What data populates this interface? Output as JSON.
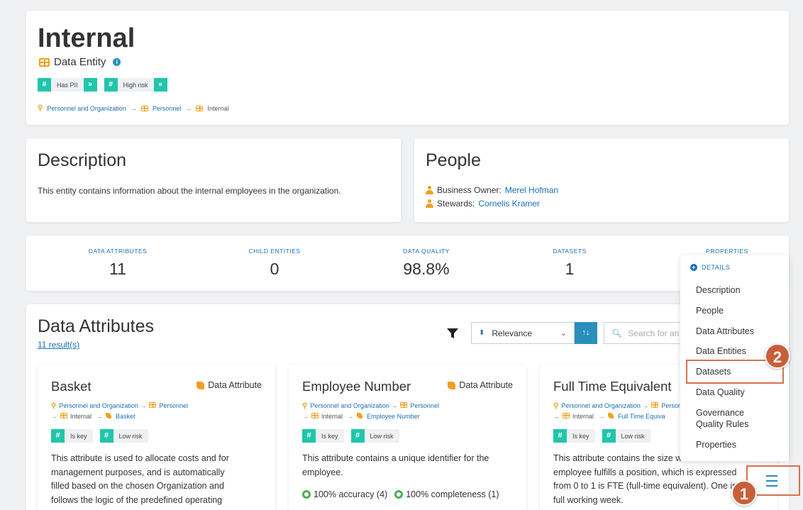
{
  "header": {
    "title": "Internal",
    "entity_type": "Data Entity",
    "tags": [
      "Has PII",
      "High risk"
    ],
    "breadcrumb": [
      "Personnel and Organization",
      "Personnel",
      "Internal"
    ]
  },
  "description": {
    "title": "Description",
    "text": "This entity contains information about the internal employees in the organization."
  },
  "people": {
    "title": "People",
    "business_owner_label": "Business Owner:",
    "business_owner": "Merel Hofman",
    "stewards_label": "Stewards:",
    "stewards": "Cornelis Kramer"
  },
  "stats": [
    {
      "label": "DATA ATTRIBUTES",
      "value": "11"
    },
    {
      "label": "CHILD ENTITIES",
      "value": "0"
    },
    {
      "label": "DATA QUALITY",
      "value": "98.8%"
    },
    {
      "label": "DATASETS",
      "value": "1"
    },
    {
      "label": "PROPERTIES",
      "value": ""
    }
  ],
  "attributes": {
    "title": "Data Attributes",
    "results": "11 result(s)",
    "sort_value": "Relevance",
    "search_placeholder": "Search for an",
    "cards": [
      {
        "name": "Basket",
        "kind": "Data Attribute",
        "path": [
          "Personnel and Organization",
          "Personnel",
          "Internal",
          "Basket"
        ],
        "tags": [
          "Is key",
          "Low risk"
        ],
        "blurb": "This attribute is used to allocate costs and for management purposes, and is automatically filled based on the chosen Organization and follows the logic of the predefined operating"
      },
      {
        "name": "Employee Number",
        "kind": "Data Attribute",
        "path": [
          "Personnel and Organization",
          "Personnel",
          "Internal",
          "Employee Number"
        ],
        "tags": [
          "Is key",
          "Low risk"
        ],
        "blurb": "This attribute contains a unique identifier for the employee.",
        "quality": [
          "100% accuracy (4)",
          "100% completeness (1)"
        ]
      },
      {
        "name": "Full Time Equivalent",
        "kind": "Data Attribute",
        "path": [
          "Personnel and Organization",
          "Personnel",
          "Internal",
          "Full Time Equiva"
        ],
        "tags": [
          "Is key",
          "Low risk"
        ],
        "blurb": "This attribute contains the size which an employee fulfills a position, which is expressed from 0 to 1 is FTE (full-time equivalent). One is a full working week."
      }
    ]
  },
  "menu": {
    "header": "DETAILS",
    "items": [
      "Description",
      "People",
      "Data Attributes",
      "Data Entities",
      "Datasets",
      "Data Quality",
      "Governance Quality Rules",
      "Properties"
    ]
  },
  "annotations": {
    "badge1": "1",
    "badge2": "2"
  },
  "colors": {
    "accent": "#1a6fb5",
    "tag": "#1fc6a9",
    "icon": "#f0a020",
    "annotation": "#c95f3a"
  }
}
